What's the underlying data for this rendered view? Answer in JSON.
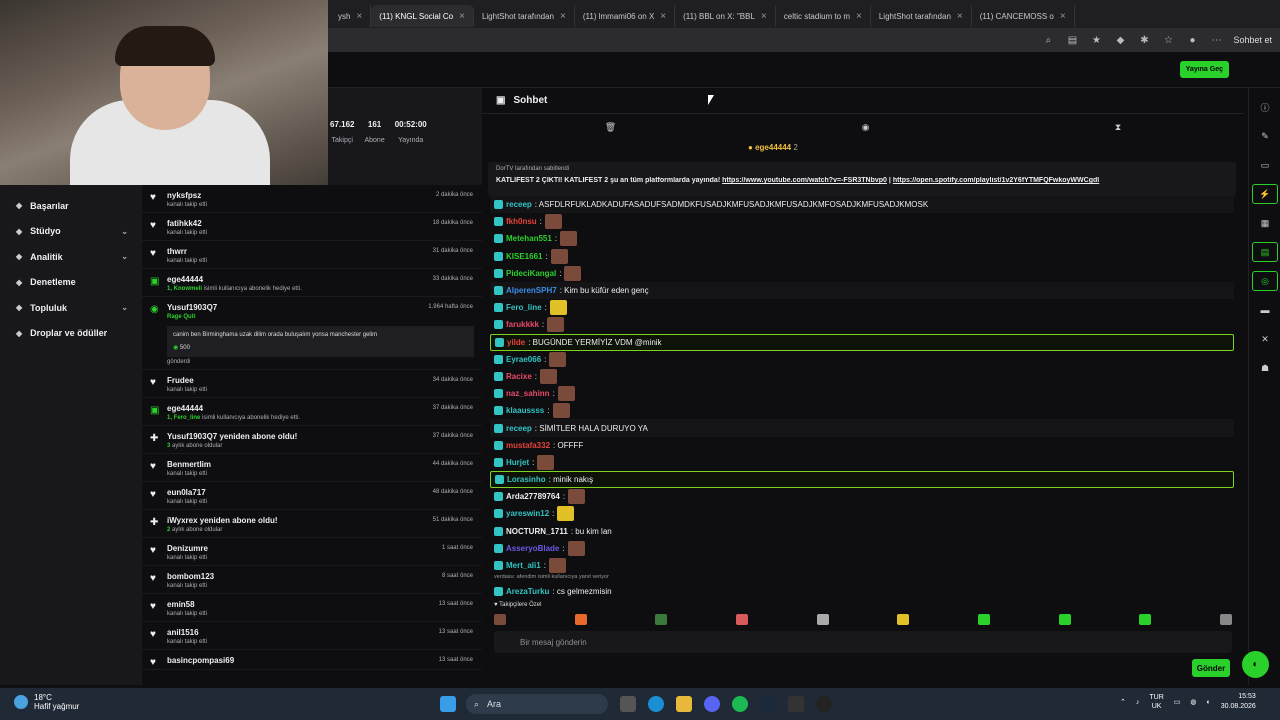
{
  "tabs": [
    {
      "label": "ysh",
      "active": false
    },
    {
      "label": "(11) KNGL Social Co",
      "active": true
    },
    {
      "label": "LightShot tarafından",
      "active": false
    },
    {
      "label": "(11) lmmami06 on X",
      "active": false
    },
    {
      "label": "(11) BBL on X: \"BBL",
      "active": false
    },
    {
      "label": "celtic stadium to m",
      "active": false
    },
    {
      "label": "LightShot tarafından",
      "active": false
    },
    {
      "label": "(11) CANCEMOSS o",
      "active": false
    }
  ],
  "toolbar": {
    "profile_label": "Sohbet et"
  },
  "header": {
    "go_live": "Yayına Geç"
  },
  "nav": [
    {
      "label": "Başarılar",
      "has_chevron": false,
      "icon": "trophy-icon"
    },
    {
      "label": "Stüdyo",
      "has_chevron": true,
      "icon": "video-icon"
    },
    {
      "label": "Analitik",
      "has_chevron": true,
      "icon": "chart-icon"
    },
    {
      "label": "Denetleme",
      "has_chevron": false,
      "icon": "wrench-icon"
    },
    {
      "label": "Topluluk",
      "has_chevron": true,
      "icon": "people-icon"
    },
    {
      "label": "Droplar ve ödüller",
      "has_chevron": false,
      "icon": "gift-icon"
    }
  ],
  "stats": [
    {
      "value": "67.162",
      "label": "Takipçi"
    },
    {
      "value": "161",
      "label": "Abone"
    },
    {
      "value": "00:52:00",
      "label": "Yayında"
    }
  ],
  "activity": [
    {
      "icon": "heart-icon",
      "name": "nyksfpsz",
      "sub": "kanalı takip etti",
      "time": "2 dakika önce"
    },
    {
      "icon": "heart-icon",
      "name": "fatihkk42",
      "sub": "kanalı takip etti",
      "time": "18 dakika önce"
    },
    {
      "icon": "heart-icon",
      "name": "thwrr",
      "sub": "kanalı takip etti",
      "time": "31 dakika önce"
    },
    {
      "icon": "gift-icon",
      "name": "ege44444",
      "subgreen": "1, Knowmeli",
      "sub": "isimli kullanıcıya abonelik hediye etti.",
      "time": "33 dakika önce"
    },
    {
      "icon": "points-icon",
      "name": "Yusuf1903Q7",
      "subgreen": "Rage Quit",
      "time": "1.964 hafta önce",
      "msg": "canim ben Birminghama uzak dilim orada buluşalım yonsa manchester gelim",
      "points": "500",
      "sub2": "gönderdi"
    },
    {
      "icon": "heart-icon",
      "name": "Frudee",
      "sub": "kanalı takip etti",
      "time": "34 dakika önce"
    },
    {
      "icon": "gift-icon",
      "name": "ege44444",
      "subgreen": "1, Fero_line",
      "sub": "isimli kullanıcıya abonelik hediye etti.",
      "time": "37 dakika önce"
    },
    {
      "icon": "star-icon",
      "name": "Yusuf1903Q7 yeniden abone oldu!",
      "subgreen": "3",
      "sub": "aylık abone oldular",
      "time": "37 dakika önce"
    },
    {
      "icon": "heart-icon",
      "name": "Benmertlim",
      "sub": "kanalı takip etti",
      "time": "44 dakika önce"
    },
    {
      "icon": "heart-icon",
      "name": "eun0la717",
      "sub": "kanalı takip etti",
      "time": "48 dakika önce"
    },
    {
      "icon": "star-icon",
      "name": "iWyxrex yeniden abone oldu!",
      "subgreen": "2",
      "sub": "aylık abone oldular",
      "time": "51 dakika önce"
    },
    {
      "icon": "heart-icon",
      "name": "Denizumre",
      "sub": "kanalı takip etti",
      "time": "1 saat önce"
    },
    {
      "icon": "heart-icon",
      "name": "bombom123",
      "sub": "kanalı takip etti",
      "time": "8 saat önce"
    },
    {
      "icon": "heart-icon",
      "name": "emin58",
      "sub": "kanalı takip etti",
      "time": "13 saat önce"
    },
    {
      "icon": "heart-icon",
      "name": "anil1516",
      "sub": "kanalı takip etti",
      "time": "13 saat önce"
    },
    {
      "icon": "heart-icon",
      "name": "basincpompasi69",
      "sub": "",
      "time": "13 saat önce"
    }
  ],
  "chat": {
    "title": "Sohbet",
    "top_user": "ege44444",
    "top_count": "2",
    "pinned_by": "DorTV tarafından sabitlendi",
    "pinned_text": "KATLİFEST 2 ÇIKTI!  KATLİFEST 2 şu an tüm platformlarda yayında!",
    "pinned_link1": "https://www.youtube.com/watch?v=-FSR3TNbvp0",
    "pinned_link2": "https://open.spotify.com/playlist/1v2Y6fYTMFQFwkoyWWCgdl",
    "followers_only": "Takipçilere Özel",
    "placeholder": "Bir mesaj gönderin",
    "send": "Gönder",
    "reply_context": "verdasu: afendim isimli kullanıcıya yanıt veriyor",
    "messages": [
      {
        "user": "receep",
        "color": "#33c4c4",
        "text": ": ASFDLRFUKLADKADUFASADUFSADMDKFUSADJKMFUSADJKMFUSADJKMFOSADJKMFUSADJKMOSK",
        "style": "dim",
        "emotes": 0
      },
      {
        "user": "fkh0nsu",
        "color": "#e8433a",
        "text": ":",
        "style": "",
        "emotes": 1
      },
      {
        "user": "Metehan551",
        "color": "#2bd12b",
        "text": ":",
        "style": "",
        "emotes": 1
      },
      {
        "user": "KISE1661",
        "color": "#2bd12b",
        "text": ":",
        "style": "",
        "emotes": 1
      },
      {
        "user": "PideciKangal",
        "color": "#2bd12b",
        "text": ":",
        "style": "",
        "emotes": 1
      },
      {
        "user": "AlperenSPH7",
        "color": "#3a8ee8",
        "text": ": Kim bu küfür eden genç",
        "style": "dim",
        "emotes": 0
      },
      {
        "user": "Fero_line",
        "color": "#33c4c4",
        "text": ":",
        "style": "",
        "emotes": 1,
        "yellow": true
      },
      {
        "user": "farukkkk",
        "color": "#e84a6a",
        "text": ":",
        "style": "",
        "emotes": 1
      },
      {
        "user": "yilde",
        "color": "#e8433a",
        "text": ": BUGÜNDE YERMİYİZ VDM @minik",
        "style": "hl",
        "emotes": 0
      },
      {
        "user": "Eyrae066",
        "color": "#33c4c4",
        "text": ":",
        "style": "",
        "emotes": 1
      },
      {
        "user": "Racixe",
        "color": "#e84a6a",
        "text": ":",
        "style": "",
        "emotes": 1
      },
      {
        "user": "naz_sahinn",
        "color": "#e84a6a",
        "text": ":",
        "style": "",
        "emotes": 1
      },
      {
        "user": "klaaussss",
        "color": "#33c4c4",
        "text": ":",
        "style": "",
        "emotes": 1
      },
      {
        "user": "receep",
        "color": "#33c4c4",
        "text": ": SİMİTLER HALA DURUYO YA",
        "style": "dim",
        "emotes": 0
      },
      {
        "user": "mustafa332",
        "color": "#e8433a",
        "text": ": OFFFF",
        "style": "",
        "emotes": 0
      },
      {
        "user": "Hurjet",
        "color": "#33c4c4",
        "text": ":",
        "style": "",
        "emotes": 1
      },
      {
        "user": "Lorasinho",
        "color": "#33c4c4",
        "text": ": minik nakış",
        "style": "hl",
        "emotes": 0
      },
      {
        "user": "Arda27789764",
        "color": "#efeff1",
        "text": ":",
        "style": "",
        "emotes": 1
      },
      {
        "user": "yareswin12",
        "color": "#33c4c4",
        "text": ":",
        "style": "",
        "emotes": 1,
        "yellow": true
      },
      {
        "user": "NOCTURN_1711",
        "color": "#efeff1",
        "text": ": bu kim lan",
        "style": "",
        "emotes": 0
      },
      {
        "user": "AsseryoBlade",
        "color": "#6a5ae8",
        "text": ":",
        "style": "",
        "emotes": 1
      },
      {
        "user": "Mert_ali1",
        "color": "#33c4c4",
        "text": ":",
        "style": "",
        "emotes": 1
      },
      {
        "user": "ArezaTurku",
        "color": "#33c4c4",
        "text": ": cs gelmezmisin",
        "style": "",
        "emotes": 0,
        "reply": true
      }
    ]
  },
  "taskbar": {
    "temp": "18°C",
    "weather": "Hafif yağmur",
    "search": "Ara",
    "lang1": "TUR",
    "lang2": "UK",
    "time": "15:53",
    "date": "30.08.2026"
  }
}
